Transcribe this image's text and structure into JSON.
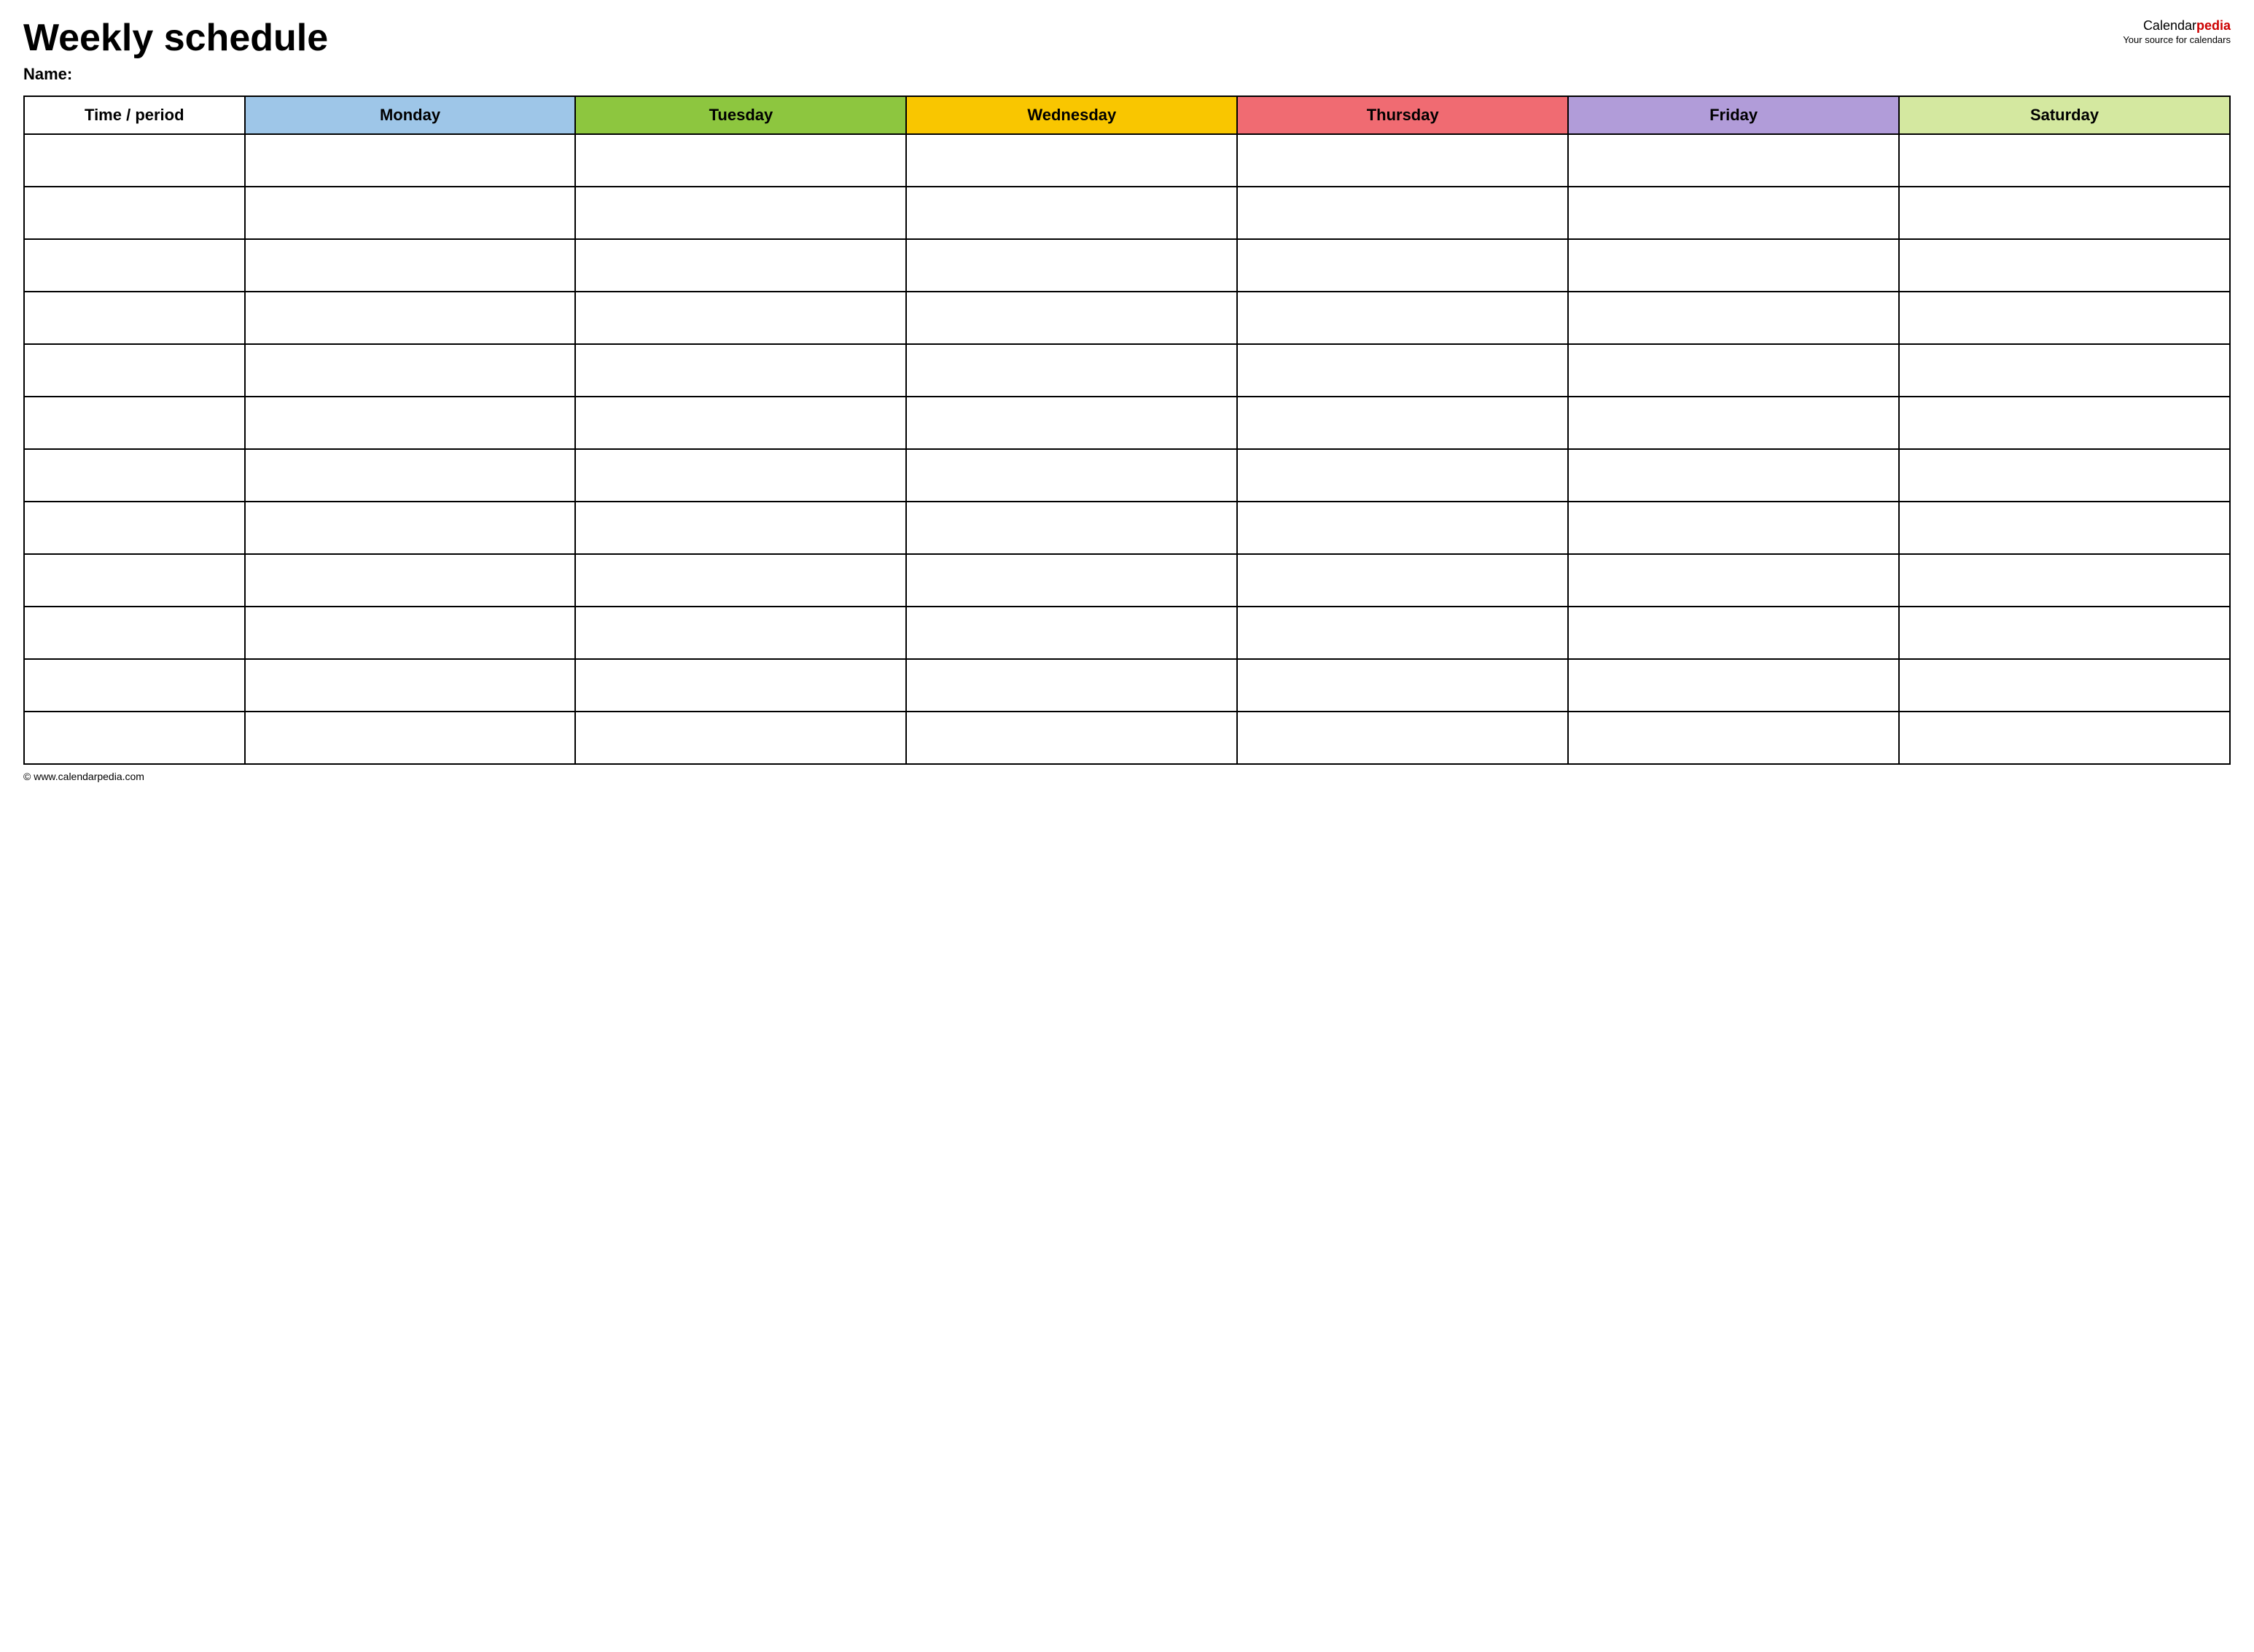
{
  "header": {
    "title": "Weekly schedule",
    "logo_calendar": "Calendar",
    "logo_pedia": "pedia",
    "logo_tagline": "Your source for calendars",
    "name_label": "Name:"
  },
  "table": {
    "columns": [
      {
        "id": "time",
        "label": "Time / period",
        "color": "#ffffff",
        "class": "th-time"
      },
      {
        "id": "monday",
        "label": "Monday",
        "color": "#9ec6e8",
        "class": "th-monday"
      },
      {
        "id": "tuesday",
        "label": "Tuesday",
        "color": "#8dc63f",
        "class": "th-tuesday"
      },
      {
        "id": "wednesday",
        "label": "Wednesday",
        "color": "#f9c600",
        "class": "th-wednesday"
      },
      {
        "id": "thursday",
        "label": "Thursday",
        "color": "#f06b72",
        "class": "th-thursday"
      },
      {
        "id": "friday",
        "label": "Friday",
        "color": "#b19cd9",
        "class": "th-friday"
      },
      {
        "id": "saturday",
        "label": "Saturday",
        "color": "#d4e8a0",
        "class": "th-saturday"
      }
    ],
    "rows": 12
  },
  "footer": {
    "url": "© www.calendarpedia.com"
  }
}
